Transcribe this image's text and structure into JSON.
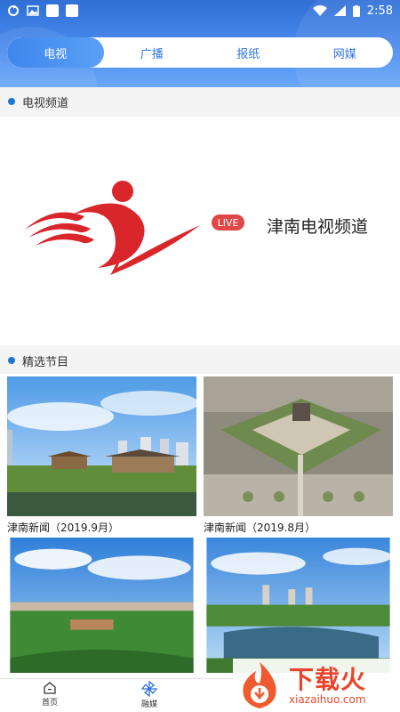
{
  "status_bar": {
    "time": "2:58",
    "icons": [
      "sync-icon",
      "image-icon",
      "square-icon",
      "square-icon",
      "wifi-icon",
      "signal-icon",
      "battery-icon"
    ]
  },
  "tabs": [
    {
      "label": "电视",
      "active": true
    },
    {
      "label": "广播",
      "active": false
    },
    {
      "label": "报纸",
      "active": false
    },
    {
      "label": "网媒",
      "active": false
    }
  ],
  "tv_section": {
    "title": "电视频道"
  },
  "live_channel": {
    "badge": "LIVE",
    "name": "津南电视频道"
  },
  "featured_section": {
    "title": "精选节目"
  },
  "programs": [
    {
      "caption": "津南新闻（2019.9月）"
    },
    {
      "caption": "津南新闻（2019.8月）"
    },
    {
      "caption": ""
    },
    {
      "caption": ""
    }
  ],
  "bottom_nav": [
    {
      "label": "首页",
      "icon": "home-icon"
    },
    {
      "label": "融媒",
      "icon": "pinwheel-icon"
    }
  ],
  "watermark": {
    "text": "下载火",
    "sub": "xiazaihuo.com"
  },
  "colors": {
    "accent": "#3477e0",
    "live_red": "#e04848",
    "logo_red": "#d9262b",
    "watermark": "#e8452c"
  }
}
